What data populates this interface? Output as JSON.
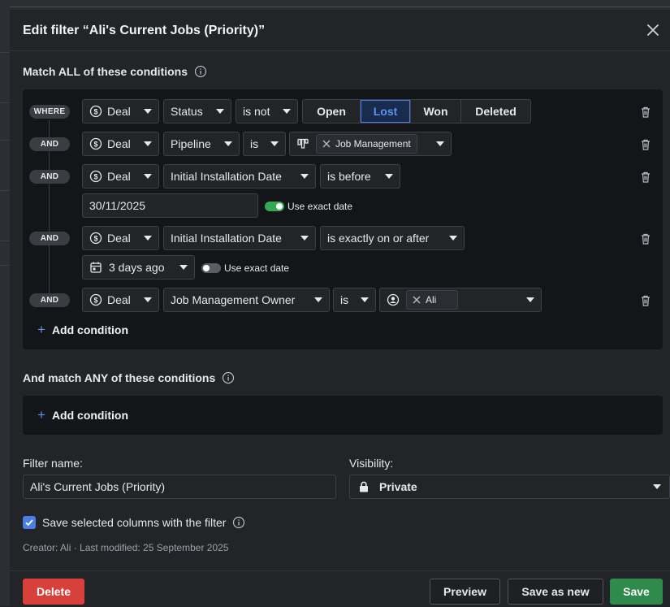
{
  "dialog": {
    "title": "Edit filter “Ali's Current Jobs (Priority)”"
  },
  "match_all": {
    "title": "Match ALL of these conditions",
    "conditions": [
      {
        "connector": "WHERE",
        "entity": "Deal",
        "field": "Status",
        "operator": "is not",
        "options": [
          "Open",
          "Lost",
          "Won",
          "Deleted"
        ],
        "selected": "Lost"
      },
      {
        "connector": "AND",
        "entity": "Deal",
        "field": "Pipeline",
        "operator": "is",
        "value_chip": "Job Management"
      },
      {
        "connector": "AND",
        "entity": "Deal",
        "field": "Initial Installation Date",
        "operator": "is before",
        "date_value": "30/11/2025",
        "exact_date_label": "Use exact date",
        "exact_date_enabled": true
      },
      {
        "connector": "AND",
        "entity": "Deal",
        "field": "Initial Installation Date",
        "operator": "is exactly on or after",
        "relative_value": "3 days ago",
        "exact_date_label": "Use exact date",
        "exact_date_enabled": false
      },
      {
        "connector": "AND",
        "entity": "Deal",
        "field": "Job Management Owner",
        "operator": "is",
        "value_chip": "Ali"
      }
    ],
    "add_label": "Add condition"
  },
  "match_any": {
    "title": "And match ANY of these conditions",
    "add_label": "Add condition"
  },
  "filter_name": {
    "label": "Filter name:",
    "value": "Ali's Current Jobs (Priority)"
  },
  "visibility": {
    "label": "Visibility:",
    "value": "Private"
  },
  "save_columns": {
    "label": "Save selected columns with the filter",
    "checked": true
  },
  "meta": "Creator: Ali · Last modified: 25 September 2025",
  "footer": {
    "delete": "Delete",
    "preview": "Preview",
    "save_as_new": "Save as new",
    "save": "Save"
  },
  "colors": {
    "accent": "#4a7ee0",
    "danger": "#d6413c",
    "success": "#2f8a4b"
  }
}
